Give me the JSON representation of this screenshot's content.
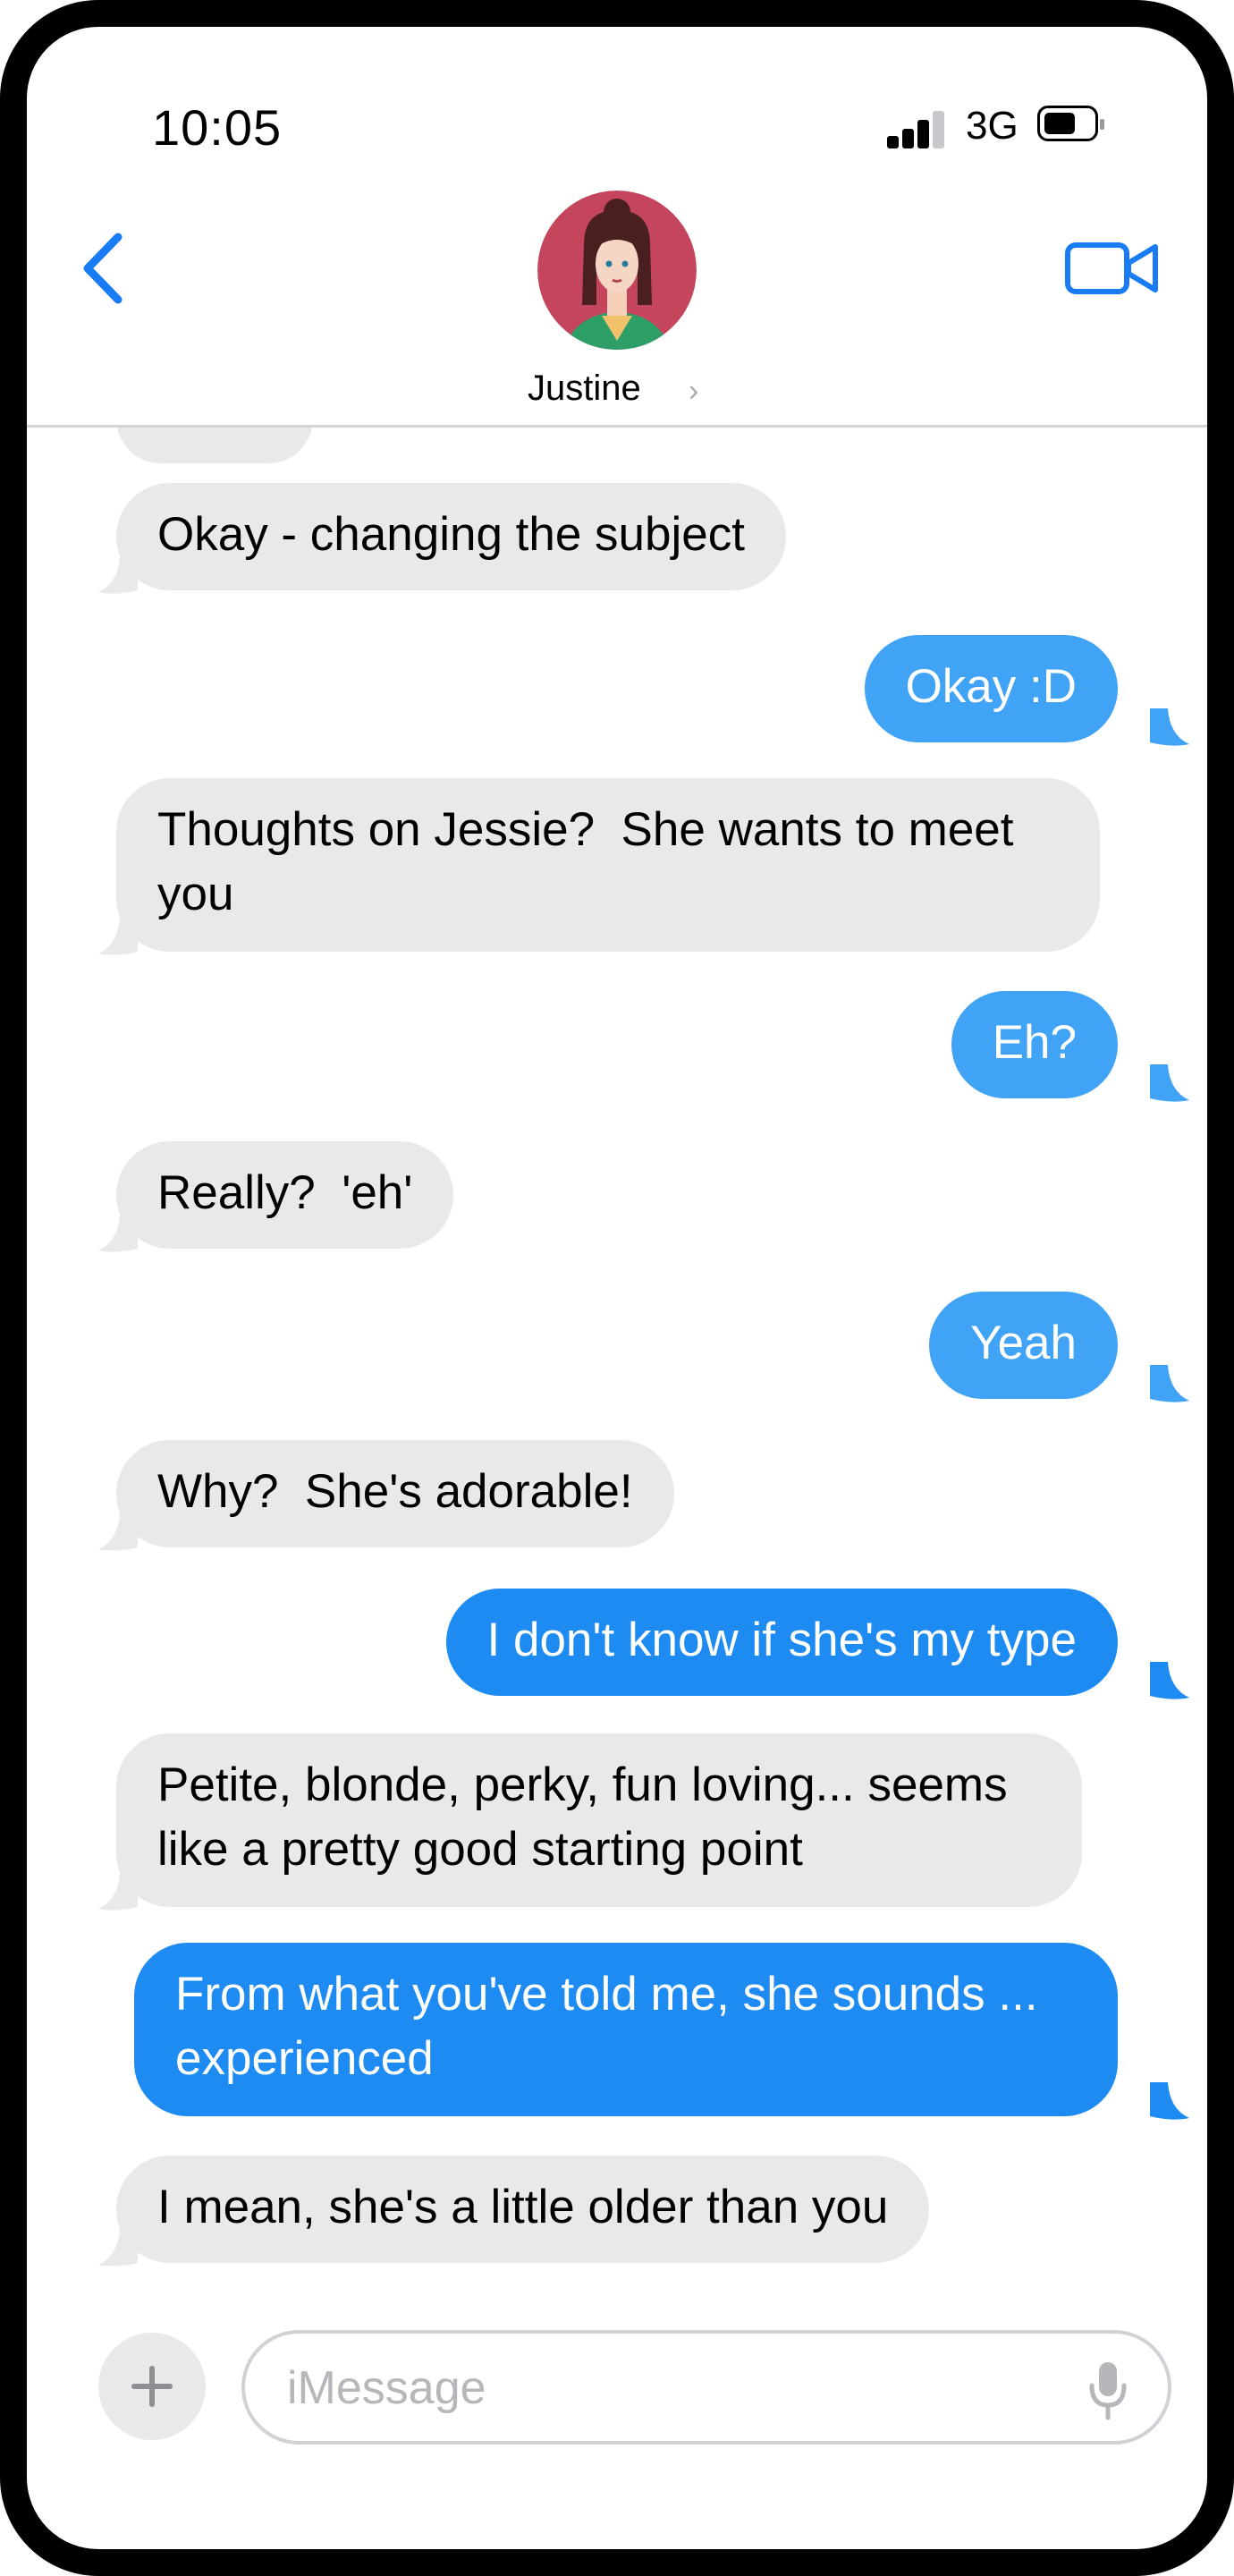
{
  "status_bar": {
    "time": "10:05",
    "network": "3G"
  },
  "header": {
    "contact_name": "Justine"
  },
  "messages": [
    {
      "from": "them",
      "text": "Okay - changing the subject"
    },
    {
      "from": "me",
      "text": "Okay :D"
    },
    {
      "from": "them",
      "text": "Thoughts on Jessie?  She wants to meet you"
    },
    {
      "from": "me",
      "text": "Eh?"
    },
    {
      "from": "them",
      "text": "Really?  'eh'"
    },
    {
      "from": "me",
      "text": "Yeah"
    },
    {
      "from": "them",
      "text": "Why?  She's adorable!"
    },
    {
      "from": "me",
      "text": "I don't know if she's my type"
    },
    {
      "from": "them",
      "text": "Petite, blonde, perky, fun loving... seems like a pretty good starting point"
    },
    {
      "from": "me",
      "text": "From what you've told me, she sounds ... experienced"
    },
    {
      "from": "them",
      "text": "I mean, she's a little older than you"
    }
  ],
  "composer": {
    "placeholder": "iMessage"
  },
  "colors": {
    "incoming": "#e9e9eb",
    "outgoing": "#41a3f5",
    "outgoing_recent": "#1d8bf2",
    "accent": "#1a7cf4"
  }
}
